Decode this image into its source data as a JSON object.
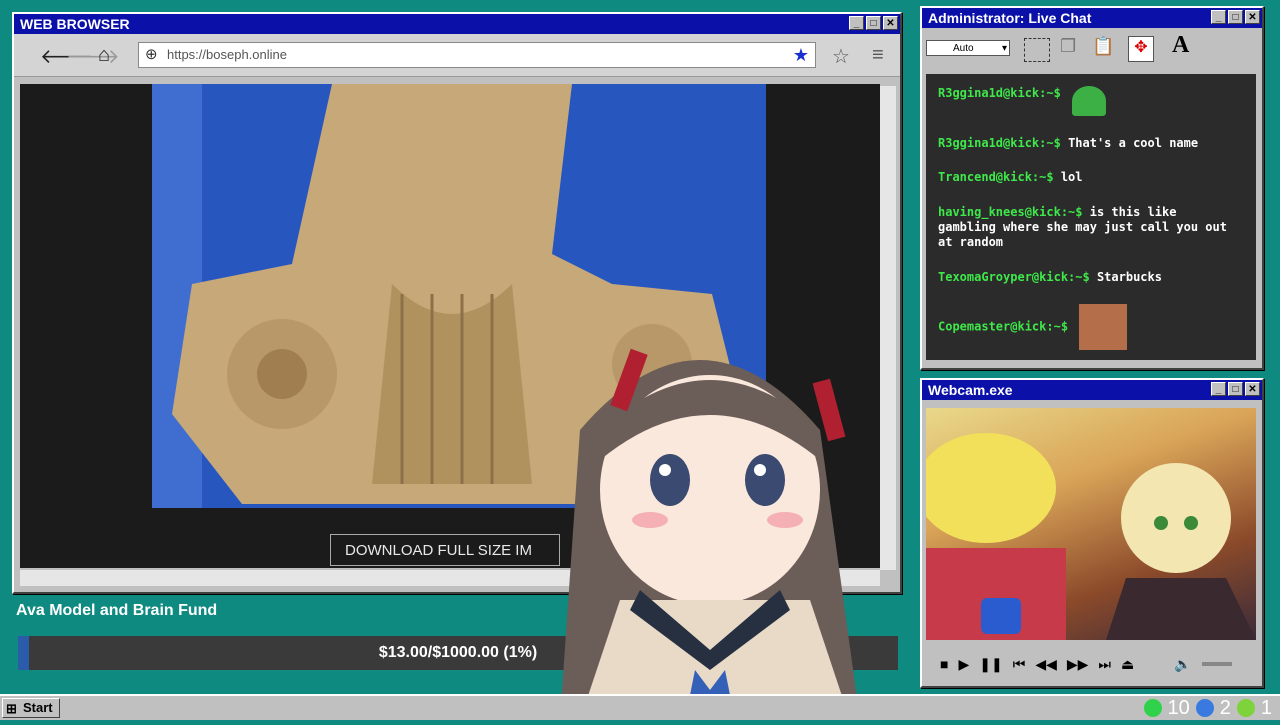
{
  "browser": {
    "title": "WEB BROWSER",
    "url": "https://boseph.online",
    "download_label": "DOWNLOAD FULL SIZE IM"
  },
  "chat": {
    "title": "Administrator: Live Chat",
    "font_select": "Auto",
    "messages": [
      {
        "user": "R3ggina1d@kick:~$",
        "text": ""
      },
      {
        "user": "R3ggina1d@kick:~$",
        "text": "That's a cool name"
      },
      {
        "user": "Trancend@kick:~$",
        "text": "lol"
      },
      {
        "user": "having_knees@kick:~$",
        "text": "is this like gambling where she may just call you out at random"
      },
      {
        "user": "TexomaGroyper@kick:~$",
        "text": "Starbucks"
      },
      {
        "user": "Copemaster@kick:~$",
        "text": ""
      }
    ]
  },
  "webcam": {
    "title": "Webcam.exe"
  },
  "fund": {
    "title": "Ava Model and Brain Fund",
    "progress_text": "$13.00/$1000.00 (1%)",
    "progress_fraction": 0.013
  },
  "taskbar": {
    "start_label": "Start",
    "tray_count_1": "10",
    "tray_count_2": "2",
    "tray_count_3": "1"
  },
  "colors": {
    "titlebar": "#0a10a8",
    "desktop": "#0e8a80",
    "chat_user": "#3ee84a"
  }
}
